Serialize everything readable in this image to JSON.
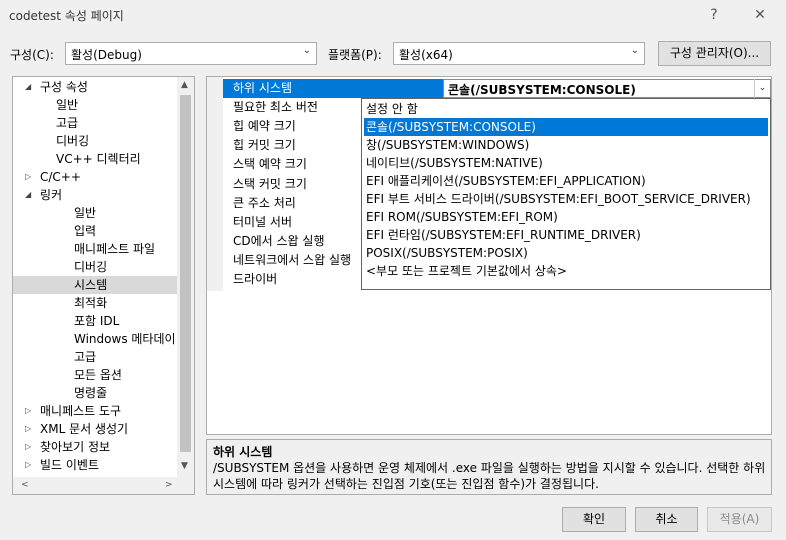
{
  "window": {
    "title": "codetest 속성 페이지",
    "help": "?",
    "close": "✕"
  },
  "config": {
    "config_label": "구성(C):",
    "config_value": "활성(Debug)",
    "platform_label": "플랫폼(P):",
    "platform_value": "활성(x64)",
    "manager_button": "구성 관리자(O)..."
  },
  "tree": {
    "items": [
      {
        "label": "구성 속성",
        "arrow": "◢"
      },
      {
        "label": "일반"
      },
      {
        "label": "고급"
      },
      {
        "label": "디버깅"
      },
      {
        "label": "VC++ 디렉터리"
      },
      {
        "label": "C/C++",
        "arrow": "▷"
      },
      {
        "label": "링커",
        "arrow": "◢"
      },
      {
        "label": "일반"
      },
      {
        "label": "입력"
      },
      {
        "label": "매니페스트 파일"
      },
      {
        "label": "디버깅"
      },
      {
        "label": "시스템"
      },
      {
        "label": "최적화"
      },
      {
        "label": "포함 IDL"
      },
      {
        "label": "Windows 메타데이"
      },
      {
        "label": "고급"
      },
      {
        "label": "모든 옵션"
      },
      {
        "label": "명령줄"
      },
      {
        "label": "매니페스트 도구",
        "arrow": "▷"
      },
      {
        "label": "XML 문서 생성기",
        "arrow": "▷"
      },
      {
        "label": "찾아보기 정보",
        "arrow": "▷"
      },
      {
        "label": "빌드 이벤트",
        "arrow": "▷"
      }
    ]
  },
  "grid": {
    "rows": [
      "하위 시스템",
      "필요한 최소 버전",
      "힙 예약 크기",
      "힙 커밋 크기",
      "스택 예약 크기",
      "스택 커밋 크기",
      "큰 주소 처리",
      "터미널 서버",
      "CD에서 스왑 실행",
      "네트워크에서 스왑 실행",
      "드라이버"
    ],
    "value": "콘솔(/SUBSYSTEM:CONSOLE)"
  },
  "dropdown": {
    "options": [
      "설정 안 함",
      "콘솔(/SUBSYSTEM:CONSOLE)",
      "창(/SUBSYSTEM:WINDOWS)",
      "네이티브(/SUBSYSTEM:NATIVE)",
      "EFI 애플리케이션(/SUBSYSTEM:EFI_APPLICATION)",
      "EFI 부트 서비스 드라이버(/SUBSYSTEM:EFI_BOOT_SERVICE_DRIVER)",
      "EFI ROM(/SUBSYSTEM:EFI_ROM)",
      "EFI 런타임(/SUBSYSTEM:EFI_RUNTIME_DRIVER)",
      "POSIX(/SUBSYSTEM:POSIX)",
      "<부모 또는 프로젝트 기본값에서 상속>"
    ]
  },
  "description": {
    "title": "하위 시스템",
    "text": "/SUBSYSTEM 옵션을 사용하면 운영 체제에서 .exe 파일을 실행하는 방법을 지시할 수 있습니다. 선택한 하위 시스템에 따라 링커가 선택하는 진입점 기호(또는 진입점 함수)가 결정됩니다."
  },
  "buttons": {
    "ok": "확인",
    "cancel": "취소",
    "apply": "적용(A)"
  },
  "colors": {
    "accent": "#0078d7",
    "tree_selected": "#d9d9d9"
  }
}
